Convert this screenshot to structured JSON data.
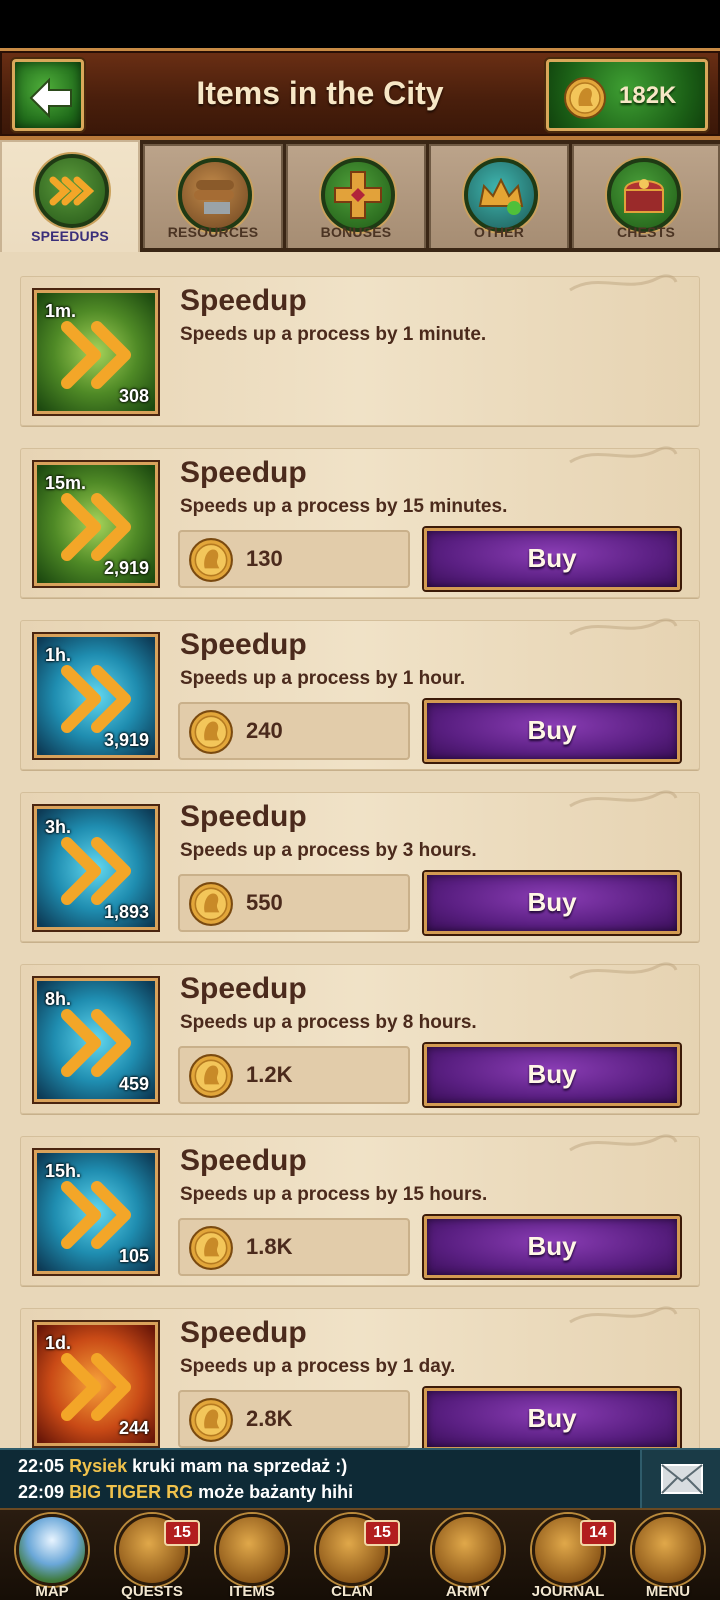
{
  "header": {
    "title": "Items in the City",
    "gold_amount": "182K"
  },
  "tabs": [
    {
      "label": "SPEEDUPS",
      "icon": "speedup-icon",
      "active": true
    },
    {
      "label": "RESOURCES",
      "icon": "resources-icon",
      "active": false
    },
    {
      "label": "BONUSES",
      "icon": "bonus-cross-icon",
      "active": false
    },
    {
      "label": "OTHER",
      "icon": "crown-icon",
      "active": false
    },
    {
      "label": "CHESTS",
      "icon": "chest-icon",
      "active": false
    }
  ],
  "items": [
    {
      "name": "Speedup",
      "duration": "1m.",
      "quantity": "308",
      "description": "Speeds up a process by 1 minute.",
      "price": null,
      "buy_label": null,
      "theme": "green"
    },
    {
      "name": "Speedup",
      "duration": "15m.",
      "quantity": "2,919",
      "description": "Speeds up a process by 15 minutes.",
      "price": "130",
      "buy_label": "Buy",
      "theme": "green"
    },
    {
      "name": "Speedup",
      "duration": "1h.",
      "quantity": "3,919",
      "description": "Speeds up a process by 1 hour.",
      "price": "240",
      "buy_label": "Buy",
      "theme": "blue"
    },
    {
      "name": "Speedup",
      "duration": "3h.",
      "quantity": "1,893",
      "description": "Speeds up a process by 3 hours.",
      "price": "550",
      "buy_label": "Buy",
      "theme": "blue"
    },
    {
      "name": "Speedup",
      "duration": "8h.",
      "quantity": "459",
      "description": "Speeds up a process by 8 hours.",
      "price": "1.2K",
      "buy_label": "Buy",
      "theme": "blue"
    },
    {
      "name": "Speedup",
      "duration": "15h.",
      "quantity": "105",
      "description": "Speeds up a process by 15 hours.",
      "price": "1.8K",
      "buy_label": "Buy",
      "theme": "blue"
    },
    {
      "name": "Speedup",
      "duration": "1d.",
      "quantity": "244",
      "description": "Speeds up a process by 1 day.",
      "price": "2.8K",
      "buy_label": "Buy",
      "theme": "red"
    }
  ],
  "chat": {
    "lines": [
      {
        "time": "22:05",
        "name": "Rysiek",
        "text": "kruki mam na sprzedaż :)"
      },
      {
        "time": "22:09",
        "name": "BIG TIGER RG",
        "text": "może bażanty hihi"
      }
    ]
  },
  "nav": [
    {
      "label": "MAP",
      "badge": null,
      "icon": "map-icon"
    },
    {
      "label": "QUESTS",
      "badge": "15",
      "icon": "quests-scroll-icon"
    },
    {
      "label": "ITEMS",
      "badge": null,
      "icon": "items-bag-icon"
    },
    {
      "label": "CLAN",
      "badge": "15",
      "icon": "clan-shield-icon"
    },
    {
      "label": "ARMY",
      "badge": null,
      "icon": "army-helmet-icon"
    },
    {
      "label": "JOURNAL",
      "badge": "14",
      "icon": "journal-letter-icon"
    },
    {
      "label": "MENU",
      "badge": null,
      "icon": "menu-book-icon"
    }
  ],
  "colors": {
    "header_brown": "#4a1f0c",
    "green_button": "#1f6a1a",
    "buy_purple": "#5a1f82",
    "parchment": "#f0e2c7",
    "text_brown": "#4b2a1c",
    "chat_bg": "#0e2a36",
    "chat_name": "#f0c24c"
  }
}
